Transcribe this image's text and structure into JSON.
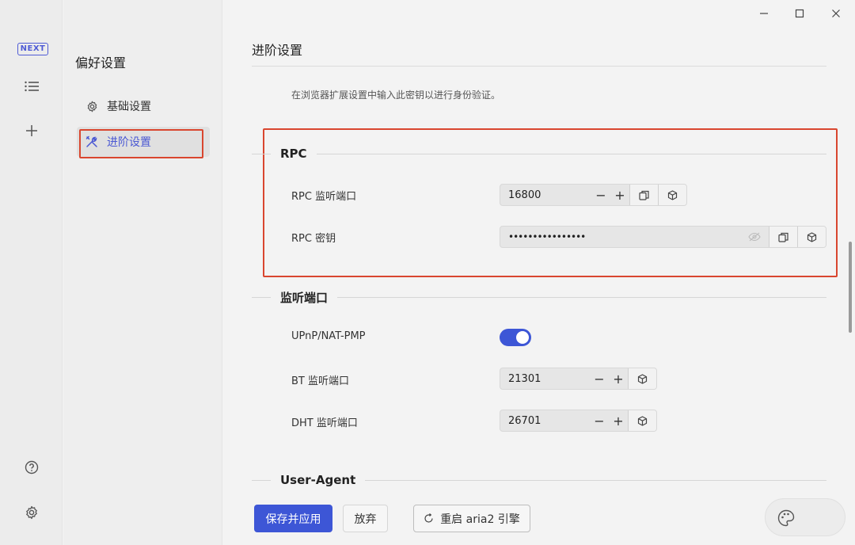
{
  "rail": {
    "logo": "NEXT",
    "icons": [
      "list-icon",
      "plus-icon",
      "help-icon",
      "gear-icon"
    ]
  },
  "sidebar": {
    "title": "偏好设置",
    "items": [
      {
        "label": "基础设置",
        "icon": "gear-icon",
        "active": false
      },
      {
        "label": "进阶设置",
        "icon": "tools-icon",
        "active": true
      }
    ]
  },
  "main": {
    "title": "进阶设置",
    "hint": "在浏览器扩展设置中输入此密钥以进行身份验证。",
    "rpc": {
      "heading": "RPC",
      "port_label": "RPC 监听端口",
      "port_value": "16800",
      "secret_label": "RPC 密钥",
      "secret_value": "••••••••••••••••"
    },
    "listen": {
      "heading": "监听端口",
      "upnp_label": "UPnP/NAT-PMP",
      "upnp_enabled": true,
      "bt_label": "BT 监听端口",
      "bt_value": "21301",
      "dht_label": "DHT 监听端口",
      "dht_value": "26701"
    },
    "ua": {
      "heading": "User-Agent"
    }
  },
  "footer": {
    "save_label": "保存并应用",
    "discard_label": "放弃",
    "restart_label": "重启 aria2 引擎"
  },
  "colors": {
    "accent": "#3d56d6",
    "highlight": "#d9462f"
  }
}
